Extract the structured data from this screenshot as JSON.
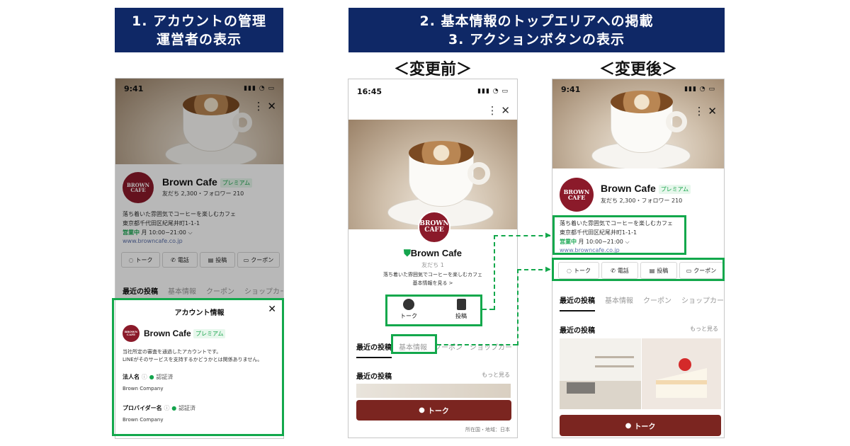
{
  "banners": {
    "left_line1": "1. アカウントの管理",
    "left_line2": "運営者の表示",
    "right_line1": "2. 基本情報のトップエリアへの掲載",
    "right_line2": "3. アクションボタンの表示"
  },
  "captions": {
    "before": "＜変更前＞",
    "after": "＜変更後＞"
  },
  "common": {
    "name": "Brown Cafe",
    "premium": "プレミアム",
    "logo_line1": "BROWN",
    "logo_line2": "CAFE",
    "stats": "友だち 2,300・フォロワー 210",
    "desc": "落ち着いた雰囲気でコーヒーを楽しむカフェ",
    "address": "東京都千代田区紀尾井町1-1-1",
    "open": "営業中",
    "hours": "月 10:00−21:00",
    "url": "www.browncafe.co.jp",
    "buttons": [
      "トーク",
      "電話",
      "投稿",
      "クーポン"
    ],
    "tabs": [
      "最近の投稿",
      "基本情報",
      "クーポン",
      "ショップカード"
    ]
  },
  "phone1": {
    "time": "9:41",
    "modal": {
      "title": "アカウント情報",
      "desc1": "当社所定の審査を通過したアカウントです。",
      "desc2": "LINEがそのサービスを支持するかどうかとは関係ありません。",
      "label1": "法人名",
      "label2": "プロバイダー名",
      "verified": "認証済",
      "value1": "Brown Company",
      "value2": "Brown Company"
    }
  },
  "phone2": {
    "time": "16:45",
    "friends": "友だち 1",
    "desc": "落ち着いた雰囲気でコーヒーを楽しむカフェ",
    "more_info": "基本情報を見る >",
    "btn1": "トーク",
    "btn2": "投稿",
    "tabs": [
      "最近の投稿",
      "基本情報",
      "クーポン",
      "ショップカー"
    ],
    "section": "最近の投稿",
    "more": "もっと見る",
    "talk": "トーク",
    "footer": "所在国・地域：日本"
  },
  "phone3": {
    "time": "9:41",
    "section": "最近の投稿",
    "more": "もっと見る",
    "talk": "トーク"
  },
  "colors": {
    "banner": "#0f2866",
    "highlight": "#13a84c",
    "talk_button": "#7b2520",
    "logo": "#8b1a2a"
  }
}
